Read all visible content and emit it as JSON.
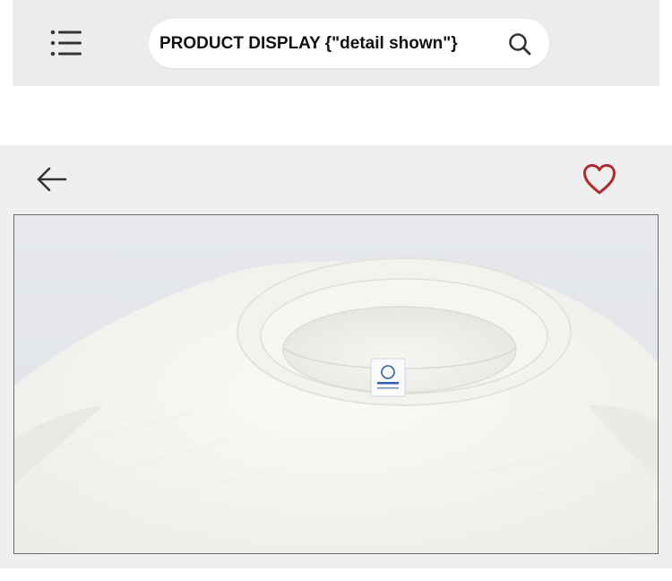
{
  "header": {
    "menu_icon": "hamburger-menu-icon",
    "search": {
      "value": "PRODUCT DISPLAY {\"detail shown\"}",
      "icon": "search-icon"
    }
  },
  "detail": {
    "back_icon": "arrow-left-icon",
    "favorite_icon": "heart-outline-icon",
    "favorite_color": "#b02a2e",
    "image": {
      "subject": "white crew-neck t-shirt collar close-up with blue label"
    }
  },
  "colors": {
    "top_bar_bg": "#ececec",
    "panel_bg": "#efefef",
    "search_bg": "#ffffff"
  }
}
